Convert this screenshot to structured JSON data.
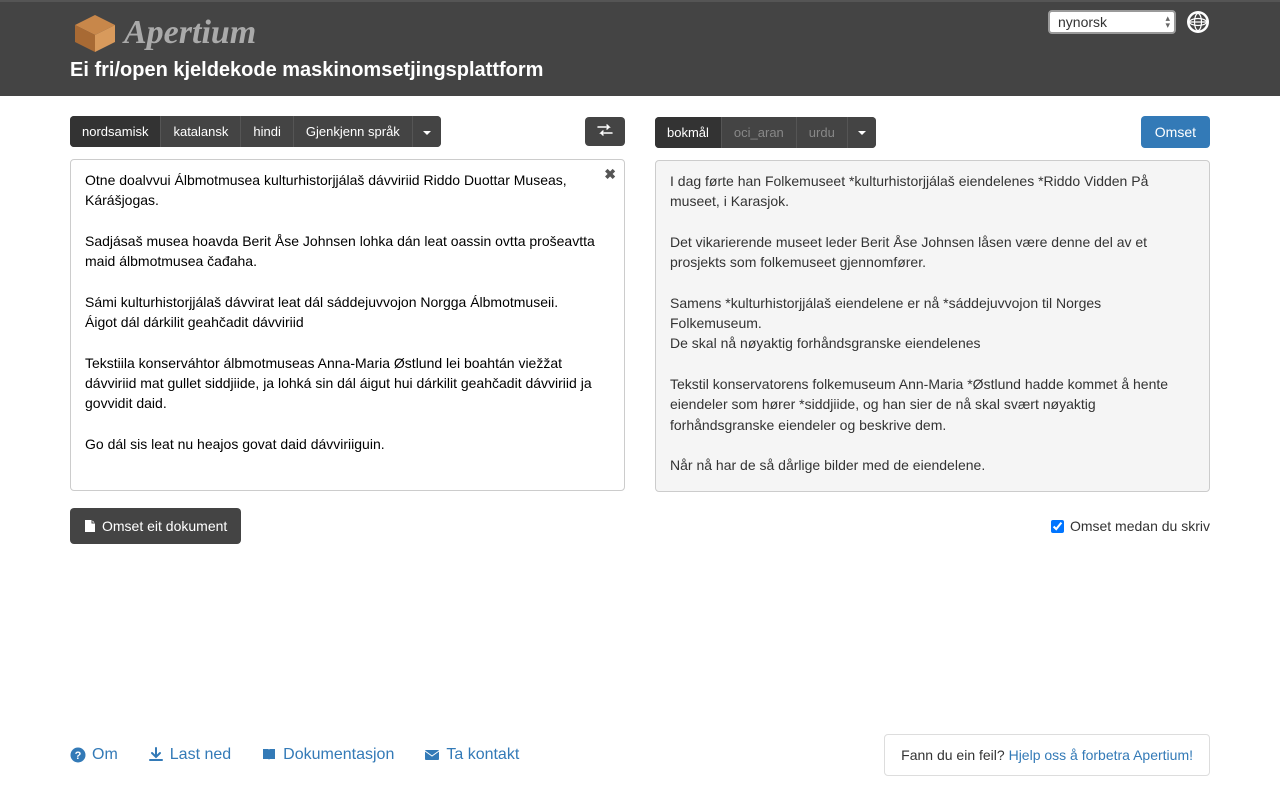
{
  "header": {
    "brand": "Apertium",
    "tagline": "Ei fri/open kjeldekode maskinomsetjingsplattform",
    "ui_language": "nynorsk"
  },
  "source": {
    "langs": [
      "nordsamisk",
      "katalansk",
      "hindi"
    ],
    "selected": "nordsamisk",
    "detect_label": "Gjenkjenn språk",
    "text": "Otne doalvvui Álbmotmusea kulturhistorjjálaš dávviriid Riddo Duottar Museas, Kárášjogas.\n\nSadjásaš musea hoavda Berit Åse Johnsen lohka dán leat oassin ovtta prošeavtta maid álbmotmusea čađaha.\n\nSámi kulturhistorjjálaš dávvirat leat dál sáddejuvvojon Norgga Álbmotmuseii.\nÁigot dál dárkilit geahčadit dávviriid\n\nTekstiila konserváhtor álbmotmuseas Anna-Maria Østlund lei boahtán viežžat dávviriid mat gullet siddjiide, ja lohká sin dál áigut hui dárkilit geahčadit dávviriid ja govvidit daid.\n\nGo dál sis leat nu heajos govat daid dávviriiguin."
  },
  "target": {
    "langs": [
      "bokmål",
      "oci_aran",
      "urdu"
    ],
    "selected": "bokmål",
    "translate_label": "Omset",
    "text": "I dag førte han Folkemuseet *kulturhistorjjálaš eiendelenes *Riddo Vidden På museet, i Karasjok.\n\nDet vikarierende museet leder Berit Åse Johnsen låsen være denne del av et prosjekts som folkemuseet gjennomfører.\n\nSamens *kulturhistorjjálaš eiendelene er nå *sáddejuvvojon til Norges Folkemuseum.\nDe skal nå nøyaktig forhåndsgranske eiendelenes\n\nTekstil konservatorens folkemuseum Ann-Maria *Østlund hadde kommet å hente eiendeler som hører *siddjiide, og han sier de nå skal svært nøyaktig forhåndsgranske eiendeler og beskrive dem.\n\nNår nå har de så dårlige bilder med de eiendelene."
  },
  "actions": {
    "translate_doc": "Omset eit dokument",
    "instant_translate": "Omset medan du skriv"
  },
  "footer": {
    "about": "Om",
    "download": "Last ned",
    "docs": "Dokumentasjon",
    "contact": "Ta kontakt",
    "bug_prompt": "Fann du ein feil? ",
    "bug_link": "Hjelp oss å forbetra Apertium!"
  }
}
